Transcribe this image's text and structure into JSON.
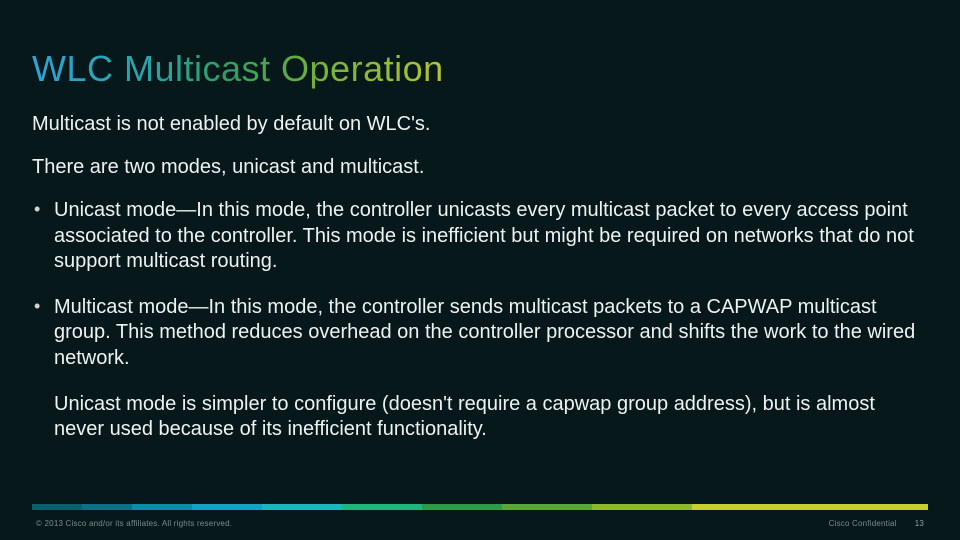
{
  "title": "WLC Multicast Operation",
  "paragraphs": {
    "p1": "Multicast is not enabled by default on WLC's.",
    "p2": "There are two modes, unicast and multicast."
  },
  "bullets": [
    "Unicast mode—In this mode, the controller unicasts every multicast packet to every access point associated to the controller. This mode is inefficient but might be required on networks that do not support multicast routing.",
    "Multicast mode—In this mode, the controller sends multicast packets to a CAPWAP multicast group. This method reduces overhead on the controller processor and shifts the work to the wired network."
  ],
  "tail": "Unicast mode is simpler to configure (doesn't require a capwap group address), but is almost never used because of its inefficient functionality.",
  "footer": {
    "copyright": "© 2013  Cisco and/or its affiliates. All rights reserved.",
    "confidential": "Cisco Confidential",
    "page": "13"
  },
  "brand_bar_widths": [
    50,
    50,
    60,
    70,
    80,
    80,
    80,
    90,
    100,
    236
  ]
}
